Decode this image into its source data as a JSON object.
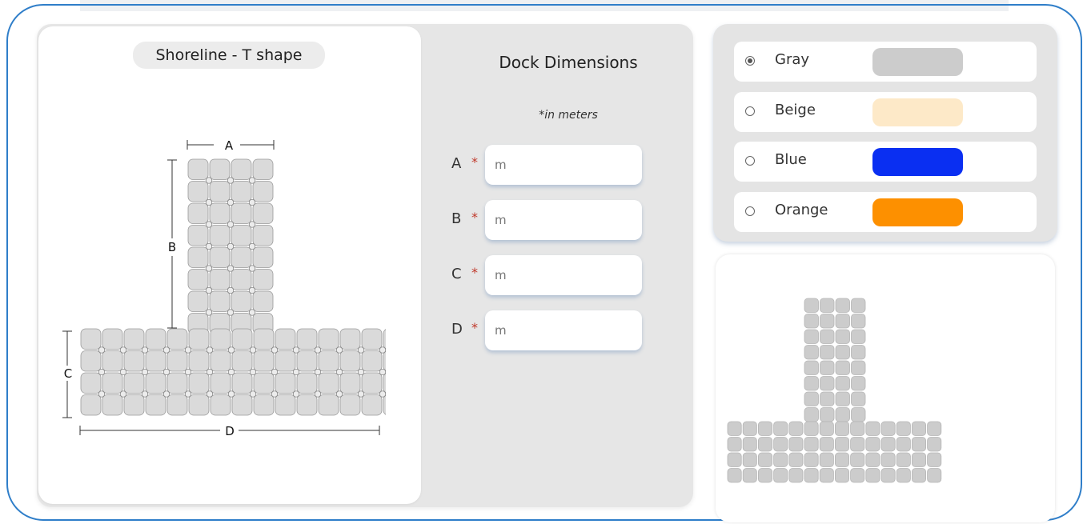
{
  "shape_title": "Shoreline - T shape",
  "diagram_labels": {
    "a": "A",
    "b": "B",
    "c": "C",
    "d": "D"
  },
  "dimensions": {
    "title": "Dock Dimensions",
    "note": "*in meters",
    "required_mark": "*",
    "fields": [
      {
        "label": "A",
        "placeholder": "m"
      },
      {
        "label": "B",
        "placeholder": "m"
      },
      {
        "label": "C",
        "placeholder": "m"
      },
      {
        "label": "D",
        "placeholder": "m"
      }
    ]
  },
  "colors": {
    "selected": "Gray",
    "options": [
      {
        "name": "Gray",
        "hex": "#cccccc"
      },
      {
        "name": "Beige",
        "hex": "#fde9c8"
      },
      {
        "name": "Blue",
        "hex": "#0a2ff2"
      },
      {
        "name": "Orange",
        "hex": "#fd9000"
      }
    ]
  }
}
